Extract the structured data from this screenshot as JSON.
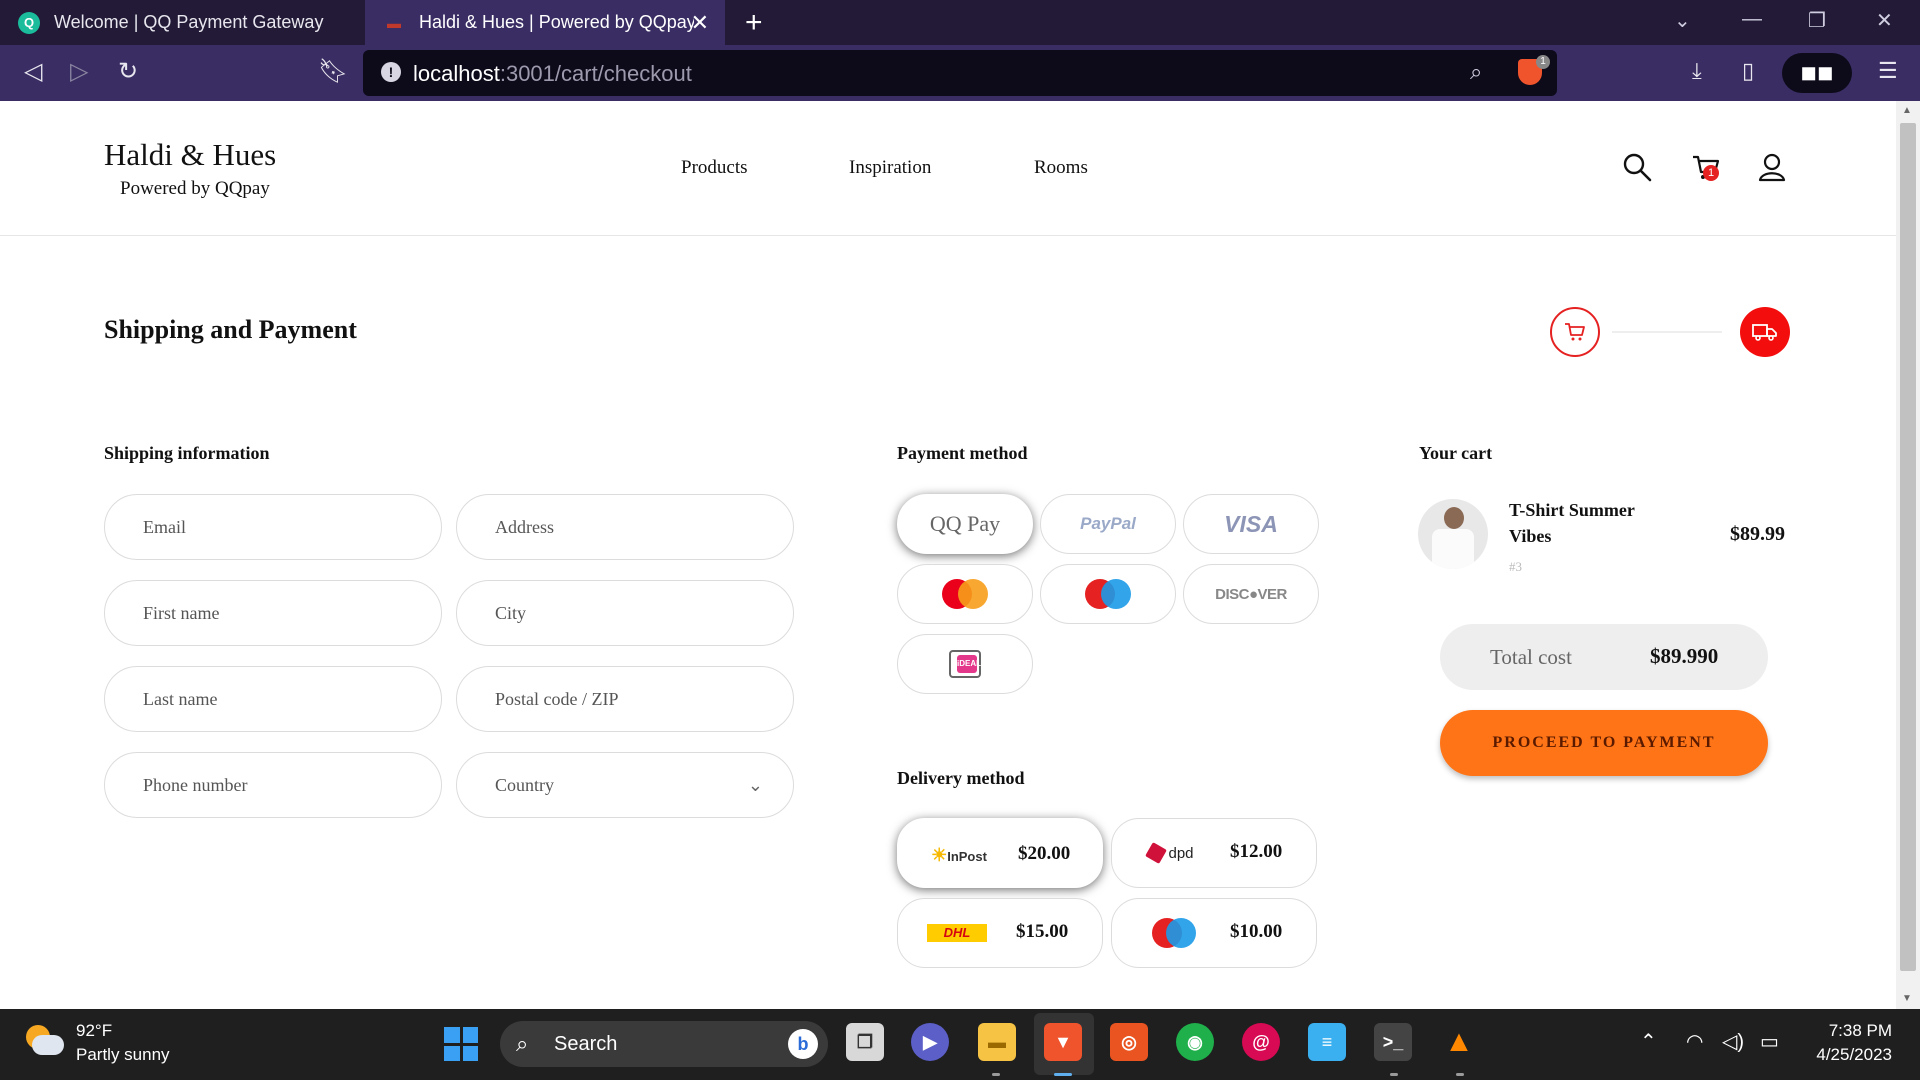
{
  "browser": {
    "tabs": [
      {
        "title": "Welcome | QQ Payment Gateway",
        "active": false
      },
      {
        "title": "Haldi & Hues | Powered by QQpay",
        "active": true
      }
    ],
    "url_host": "localhost",
    "url_path": ":3001/cart/checkout",
    "shield_count": "1"
  },
  "site": {
    "brand": "Haldi & Hues",
    "brand_sub": "Powered by QQpay",
    "nav": [
      "Products",
      "Inspiration",
      "Rooms"
    ],
    "cart_count": "1"
  },
  "page": {
    "title": "Shipping and Payment",
    "steps": [
      "cart",
      "shipping"
    ],
    "active_step": "shipping"
  },
  "shipping": {
    "heading": "Shipping information",
    "fields": {
      "email": "Email",
      "address": "Address",
      "first_name": "First name",
      "city": "City",
      "last_name": "Last name",
      "postal": "Postal code / ZIP",
      "phone": "Phone number",
      "country": "Country"
    }
  },
  "payment": {
    "heading": "Payment method",
    "options": [
      {
        "name": "QQ Pay",
        "selected": true
      },
      {
        "name": "PayPal",
        "selected": false
      },
      {
        "name": "VISA",
        "selected": false
      },
      {
        "name": "mastercard",
        "selected": false
      },
      {
        "name": "maestro",
        "selected": false
      },
      {
        "name": "DISCOVER",
        "selected": false
      },
      {
        "name": "iDEAL",
        "selected": false
      }
    ],
    "labels": {
      "qqpay": "QQ Pay",
      "paypal": "PayPal",
      "visa": "VISA",
      "discover": "DISC●VER",
      "ideal": "iDEAL"
    }
  },
  "delivery": {
    "heading": "Delivery method",
    "options": [
      {
        "carrier": "InPost",
        "price": "$20.00",
        "selected": true
      },
      {
        "carrier": "dpd",
        "price": "$12.00",
        "selected": false
      },
      {
        "carrier": "DHL",
        "price": "$15.00",
        "selected": false
      },
      {
        "carrier": "maestro",
        "price": "$10.00",
        "selected": false
      }
    ]
  },
  "cart": {
    "heading": "Your cart",
    "item": {
      "name": "T-Shirt Summer Vibes",
      "id": "#3",
      "price": "$89.99"
    },
    "total_label": "Total cost",
    "total_value": "$89.990",
    "proceed_label": "PROCEED TO PAYMENT"
  },
  "taskbar": {
    "temperature": "92°F",
    "condition": "Partly sunny",
    "search_label": "Search",
    "time": "7:38 PM",
    "date": "4/25/2023"
  },
  "colors": {
    "accent_red": "#f30d0d",
    "proceed_orange": "#ff7416",
    "browser_purple": "#3a2d63"
  }
}
